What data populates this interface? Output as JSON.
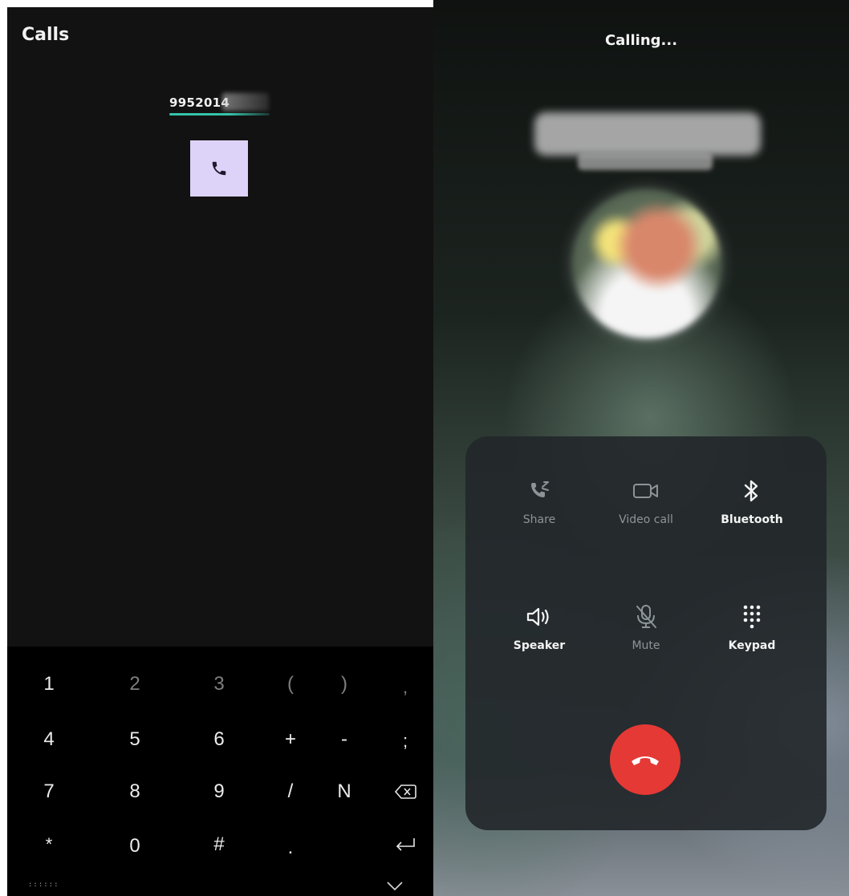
{
  "dialer": {
    "title": "Calls",
    "number_visible": "9952014",
    "keyboard": {
      "rows": [
        [
          "1",
          "2",
          "3",
          "(",
          ")",
          ","
        ],
        [
          "4",
          "5",
          "6",
          "+",
          "-",
          ";"
        ],
        [
          "7",
          "8",
          "9",
          "/",
          "N",
          ""
        ],
        [
          "*",
          "0",
          "#",
          ".",
          "",
          ""
        ]
      ],
      "grip": "::::::"
    }
  },
  "call_screen": {
    "status": "Calling...",
    "controls": {
      "share": "Share",
      "video_call": "Video call",
      "bluetooth": "Bluetooth",
      "speaker": "Speaker",
      "mute": "Mute",
      "keypad": "Keypad"
    },
    "colors": {
      "end_call": "#e53935",
      "call_button": "#ddd2f7",
      "accent": "#35c3a8"
    }
  }
}
